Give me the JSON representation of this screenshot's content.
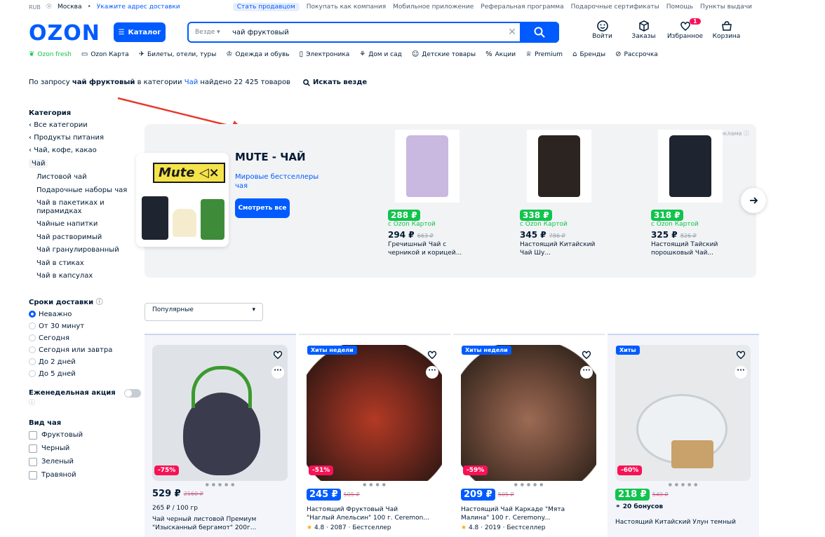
{
  "topbar": {
    "currency": "RUB",
    "location": "Москва",
    "address_link": "Укажите адрес доставки",
    "links": [
      "Стать продавцом",
      "Покупать как компания",
      "Мобильное приложение",
      "Реферальная программа",
      "Подарочные сертификаты",
      "Помощь",
      "Пункты выдачи"
    ]
  },
  "header": {
    "logo": "OZON",
    "catalog": "Каталог",
    "search_scope": "Везде",
    "search_value": "чай фруктовый",
    "icons": [
      {
        "label": "Войти",
        "icon": "smile-icon"
      },
      {
        "label": "Заказы",
        "icon": "box-icon"
      },
      {
        "label": "Избранное",
        "icon": "heart-icon",
        "badge": "1"
      },
      {
        "label": "Корзина",
        "icon": "cart-icon"
      }
    ]
  },
  "nav": [
    "Ozon fresh",
    "Ozon Карта",
    "Билеты, отели, туры",
    "Одежда и обувь",
    "Электроника",
    "Дом и сад",
    "Детские товары",
    "Акции",
    "Premium",
    "Бренды",
    "Рассрочка"
  ],
  "query": {
    "prefix": "По запросу",
    "term": "чай фруктовый",
    "mid": "в категории",
    "category": "Чай",
    "suffix": "найдено 22 425 товаров",
    "search_all": "Искать везде"
  },
  "sidebar": {
    "category_title": "Категория",
    "back_links": [
      "Все категории",
      "Продукты питания",
      "Чай, кофе, какао"
    ],
    "selected": "Чай",
    "subs": [
      "Листовой чай",
      "Подарочные наборы чая",
      "Чай в пакетиках и пирамидках",
      "Чайные напитки",
      "Чай растворимый",
      "Чай гранулированный",
      "Чай в стиках",
      "Чай в капсулах"
    ],
    "delivery_title": "Сроки доставки",
    "delivery": [
      "Неважно",
      "От 30 минут",
      "Сегодня",
      "Сегодня или завтра",
      "До 2 дней",
      "До 5 дней"
    ],
    "weekly": "Еженедельная акция",
    "tea_type_title": "Вид чая",
    "tea_types": [
      "Фруктовый",
      "Черный",
      "Зеленый",
      "Травяной"
    ]
  },
  "promo": {
    "ad_label": "Реклама",
    "brand_logo": "Mute",
    "title": "MUTE - ЧАЙ",
    "subtitle": "Мировые бестселлеры чая",
    "button": "Смотреть все",
    "cards": [
      {
        "price": "288 ₽",
        "card_label": "с Ozon Картой",
        "price2": "294 ₽",
        "old": "663 ₽",
        "name": "Гречишный Чай с черникой и корицей...",
        "color": "#c9b8e0"
      },
      {
        "price": "338 ₽",
        "card_label": "с Ozon Картой",
        "price2": "345 ₽",
        "old": "786 ₽",
        "name": "Настоящий Китайский Чай Шу...",
        "color": "#2b2421"
      },
      {
        "price": "318 ₽",
        "card_label": "с Ozon Картой",
        "price2": "325 ₽",
        "old": "826 ₽",
        "name": "Настоящий Тайский порошковый Чай...",
        "color": "#1e2430"
      }
    ]
  },
  "sort": "Популярные",
  "products": [
    {
      "badge": "",
      "discount": "-75%",
      "price": "529 ₽",
      "old": "2160 ₽",
      "line1": "265 ₽ / 100 гр",
      "line2": "Чай черный листовой Премиум",
      "line3": "\"Изысканный бергамот\" 200г...",
      "chip": false,
      "bg": "#dfe3e8"
    },
    {
      "badge": "Хиты недели",
      "discount": "-51%",
      "price": "245 ₽",
      "old": "505 ₽",
      "line1": "Настоящий Фруктовый Чай",
      "line2": "\"Наглый Апельсин\" 100 г. Ceremon...",
      "line3": "4.8 · 2087 · Бестселлер",
      "chip": true,
      "bg": "#7a2a1e"
    },
    {
      "badge": "Хиты недели",
      "discount": "-59%",
      "price": "209 ₽",
      "old": "505 ₽",
      "line1": "Настоящий Чай Каркаде \"Мята",
      "line2": "Малина\" 100 г. Ceremony...",
      "line3": "4.8 · 2019 · Бестселлер",
      "chip": true,
      "bg": "#6f4a3a"
    },
    {
      "badge": "Хиты",
      "discount": "-60%",
      "price": "218 ₽",
      "old": "540 ₽",
      "line1": "20 бонусов",
      "line2": "Настоящий Китайский Улун темный",
      "line3": "",
      "chip": "green",
      "bg": "#e7e9ea"
    }
  ]
}
